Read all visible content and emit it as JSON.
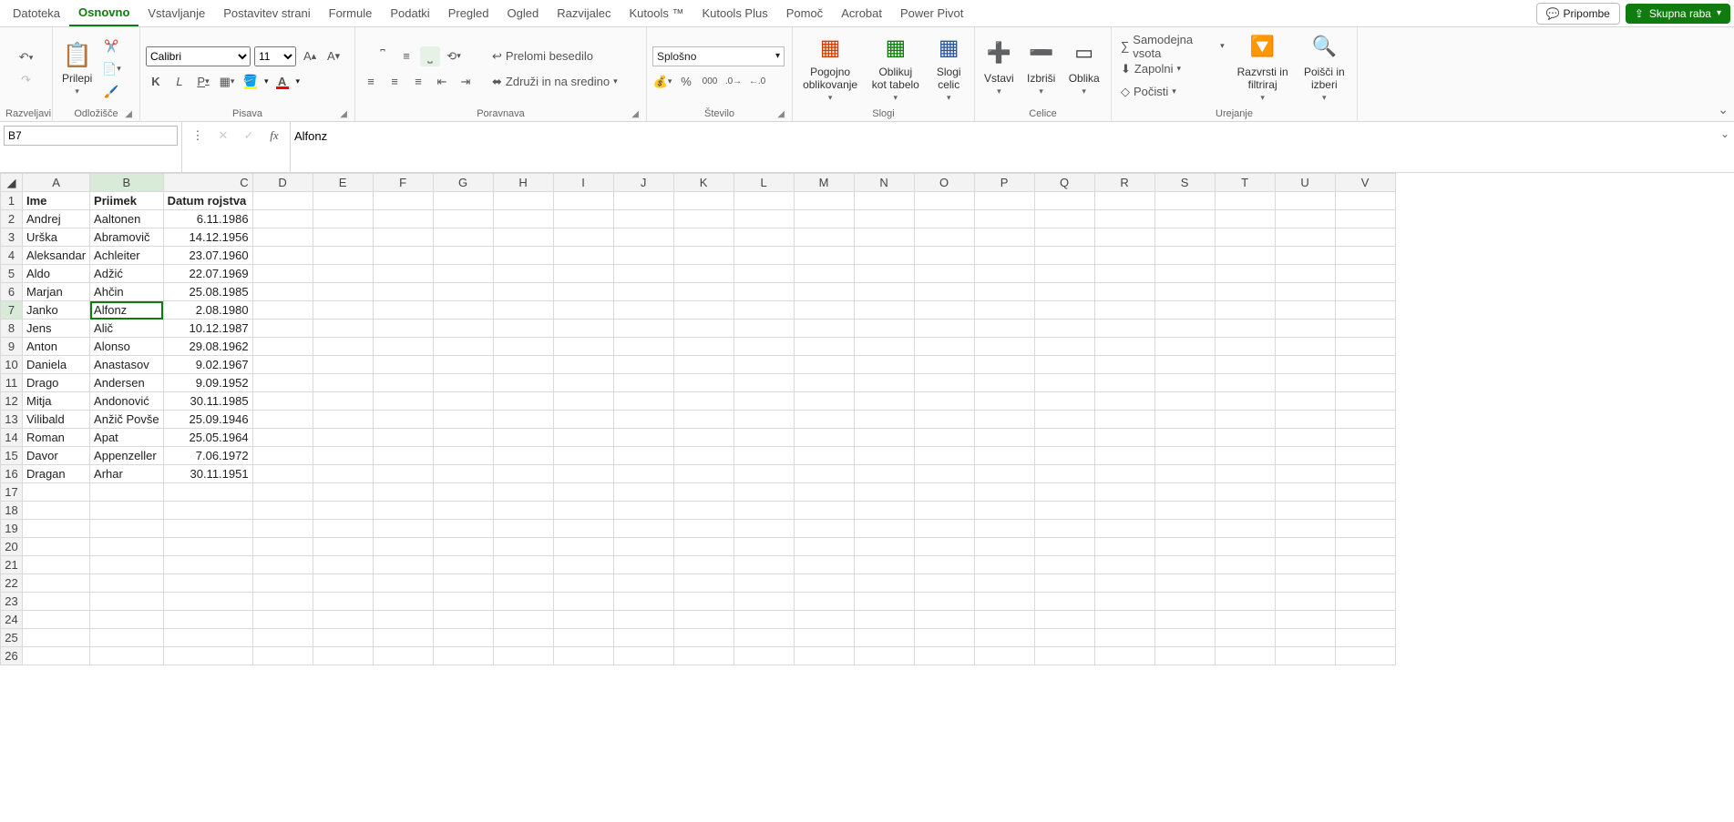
{
  "tabs": [
    "Datoteka",
    "Osnovno",
    "Vstavljanje",
    "Postavitev strani",
    "Formule",
    "Podatki",
    "Pregled",
    "Ogled",
    "Razvijalec",
    "Kutools ™",
    "Kutools Plus",
    "Pomoč",
    "Acrobat",
    "Power Pivot"
  ],
  "active_tab": "Osnovno",
  "header": {
    "comments": "Pripombe",
    "share": "Skupna raba"
  },
  "ribbon": {
    "undo_group": "Razveljavi",
    "clipboard_group": "Odložišče",
    "paste": "Prilepi",
    "font_group": "Pisava",
    "font_name": "Calibri",
    "font_size": "11",
    "bold": "K",
    "italic": "L",
    "underline": "P",
    "fill_color": "#ffff00",
    "font_color": "#ff0000",
    "align_group": "Poravnava",
    "wrap": "Prelomi besedilo",
    "merge": "Združi in na sredino",
    "number_group": "Število",
    "number_format": "Splošno",
    "styles_group": "Slogi",
    "cond_fmt": "Pogojno oblikovanje",
    "as_table": "Oblikuj kot tabelo",
    "cell_styles": "Slogi celic",
    "cells_group": "Celice",
    "insert": "Vstavi",
    "delete": "Izbriši",
    "format": "Oblika",
    "editing_group": "Urejanje",
    "autosum": "Samodejna vsota",
    "fill": "Zapolni",
    "clear": "Počisti",
    "sort": "Razvrsti in filtriraj",
    "find": "Poišči in izberi"
  },
  "name_box": "B7",
  "formula_bar": "Alfonz",
  "columns": [
    "A",
    "B",
    "C",
    "D",
    "E",
    "F",
    "G",
    "H",
    "I",
    "J",
    "K",
    "L",
    "M",
    "N",
    "O",
    "P",
    "Q",
    "R",
    "S",
    "T",
    "U",
    "V"
  ],
  "active_cell": {
    "row": 7,
    "col": "B"
  },
  "headers": {
    "A": "Ime",
    "B": "Priimek",
    "C": "Datum rojstva"
  },
  "rows": [
    {
      "A": "Andrej",
      "B": "Aaltonen",
      "C": "6.11.1986"
    },
    {
      "A": "Urška",
      "B": "Abramovič",
      "C": "14.12.1956"
    },
    {
      "A": "Aleksandar",
      "B": "Achleiter",
      "C": "23.07.1960"
    },
    {
      "A": "Aldo",
      "B": "Adžić",
      "C": "22.07.1969"
    },
    {
      "A": "Marjan",
      "B": "Ahčin",
      "C": "25.08.1985"
    },
    {
      "A": "Janko",
      "B": "Alfonz",
      "C": "2.08.1980"
    },
    {
      "A": "Jens",
      "B": "Alič",
      "C": "10.12.1987"
    },
    {
      "A": "Anton",
      "B": "Alonso",
      "C": "29.08.1962"
    },
    {
      "A": "Daniela",
      "B": "Anastasov",
      "C": "9.02.1967"
    },
    {
      "A": "Drago",
      "B": "Andersen",
      "C": "9.09.1952"
    },
    {
      "A": "Mitja",
      "B": "Andonović",
      "C": "30.11.1985"
    },
    {
      "A": "Vilibald",
      "B": "Anžič Povše",
      "C": "25.09.1946"
    },
    {
      "A": "Roman",
      "B": "Apat",
      "C": "25.05.1964"
    },
    {
      "A": "Davor",
      "B": "Appenzeller",
      "C": "7.06.1972"
    },
    {
      "A": "Dragan",
      "B": "Arhar",
      "C": "30.11.1951"
    }
  ],
  "total_visible_rows": 26
}
